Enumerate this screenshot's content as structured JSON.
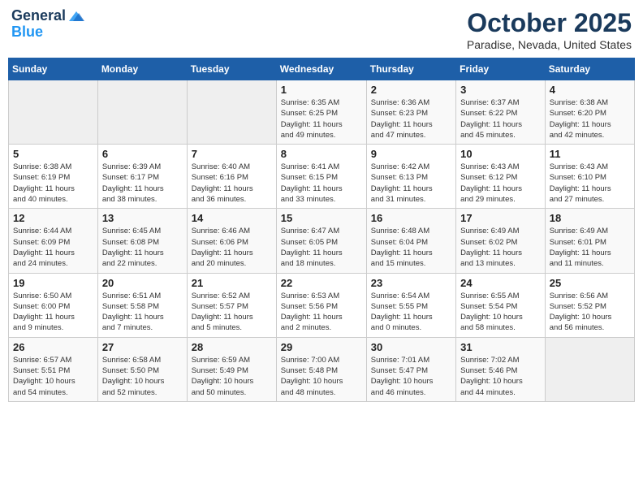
{
  "header": {
    "logo_general": "General",
    "logo_blue": "Blue",
    "month": "October 2025",
    "location": "Paradise, Nevada, United States"
  },
  "days_of_week": [
    "Sunday",
    "Monday",
    "Tuesday",
    "Wednesday",
    "Thursday",
    "Friday",
    "Saturday"
  ],
  "weeks": [
    [
      {
        "day": "",
        "info": ""
      },
      {
        "day": "",
        "info": ""
      },
      {
        "day": "",
        "info": ""
      },
      {
        "day": "1",
        "info": "Sunrise: 6:35 AM\nSunset: 6:25 PM\nDaylight: 11 hours\nand 49 minutes."
      },
      {
        "day": "2",
        "info": "Sunrise: 6:36 AM\nSunset: 6:23 PM\nDaylight: 11 hours\nand 47 minutes."
      },
      {
        "day": "3",
        "info": "Sunrise: 6:37 AM\nSunset: 6:22 PM\nDaylight: 11 hours\nand 45 minutes."
      },
      {
        "day": "4",
        "info": "Sunrise: 6:38 AM\nSunset: 6:20 PM\nDaylight: 11 hours\nand 42 minutes."
      }
    ],
    [
      {
        "day": "5",
        "info": "Sunrise: 6:38 AM\nSunset: 6:19 PM\nDaylight: 11 hours\nand 40 minutes."
      },
      {
        "day": "6",
        "info": "Sunrise: 6:39 AM\nSunset: 6:17 PM\nDaylight: 11 hours\nand 38 minutes."
      },
      {
        "day": "7",
        "info": "Sunrise: 6:40 AM\nSunset: 6:16 PM\nDaylight: 11 hours\nand 36 minutes."
      },
      {
        "day": "8",
        "info": "Sunrise: 6:41 AM\nSunset: 6:15 PM\nDaylight: 11 hours\nand 33 minutes."
      },
      {
        "day": "9",
        "info": "Sunrise: 6:42 AM\nSunset: 6:13 PM\nDaylight: 11 hours\nand 31 minutes."
      },
      {
        "day": "10",
        "info": "Sunrise: 6:43 AM\nSunset: 6:12 PM\nDaylight: 11 hours\nand 29 minutes."
      },
      {
        "day": "11",
        "info": "Sunrise: 6:43 AM\nSunset: 6:10 PM\nDaylight: 11 hours\nand 27 minutes."
      }
    ],
    [
      {
        "day": "12",
        "info": "Sunrise: 6:44 AM\nSunset: 6:09 PM\nDaylight: 11 hours\nand 24 minutes."
      },
      {
        "day": "13",
        "info": "Sunrise: 6:45 AM\nSunset: 6:08 PM\nDaylight: 11 hours\nand 22 minutes."
      },
      {
        "day": "14",
        "info": "Sunrise: 6:46 AM\nSunset: 6:06 PM\nDaylight: 11 hours\nand 20 minutes."
      },
      {
        "day": "15",
        "info": "Sunrise: 6:47 AM\nSunset: 6:05 PM\nDaylight: 11 hours\nand 18 minutes."
      },
      {
        "day": "16",
        "info": "Sunrise: 6:48 AM\nSunset: 6:04 PM\nDaylight: 11 hours\nand 15 minutes."
      },
      {
        "day": "17",
        "info": "Sunrise: 6:49 AM\nSunset: 6:02 PM\nDaylight: 11 hours\nand 13 minutes."
      },
      {
        "day": "18",
        "info": "Sunrise: 6:49 AM\nSunset: 6:01 PM\nDaylight: 11 hours\nand 11 minutes."
      }
    ],
    [
      {
        "day": "19",
        "info": "Sunrise: 6:50 AM\nSunset: 6:00 PM\nDaylight: 11 hours\nand 9 minutes."
      },
      {
        "day": "20",
        "info": "Sunrise: 6:51 AM\nSunset: 5:58 PM\nDaylight: 11 hours\nand 7 minutes."
      },
      {
        "day": "21",
        "info": "Sunrise: 6:52 AM\nSunset: 5:57 PM\nDaylight: 11 hours\nand 5 minutes."
      },
      {
        "day": "22",
        "info": "Sunrise: 6:53 AM\nSunset: 5:56 PM\nDaylight: 11 hours\nand 2 minutes."
      },
      {
        "day": "23",
        "info": "Sunrise: 6:54 AM\nSunset: 5:55 PM\nDaylight: 11 hours\nand 0 minutes."
      },
      {
        "day": "24",
        "info": "Sunrise: 6:55 AM\nSunset: 5:54 PM\nDaylight: 10 hours\nand 58 minutes."
      },
      {
        "day": "25",
        "info": "Sunrise: 6:56 AM\nSunset: 5:52 PM\nDaylight: 10 hours\nand 56 minutes."
      }
    ],
    [
      {
        "day": "26",
        "info": "Sunrise: 6:57 AM\nSunset: 5:51 PM\nDaylight: 10 hours\nand 54 minutes."
      },
      {
        "day": "27",
        "info": "Sunrise: 6:58 AM\nSunset: 5:50 PM\nDaylight: 10 hours\nand 52 minutes."
      },
      {
        "day": "28",
        "info": "Sunrise: 6:59 AM\nSunset: 5:49 PM\nDaylight: 10 hours\nand 50 minutes."
      },
      {
        "day": "29",
        "info": "Sunrise: 7:00 AM\nSunset: 5:48 PM\nDaylight: 10 hours\nand 48 minutes."
      },
      {
        "day": "30",
        "info": "Sunrise: 7:01 AM\nSunset: 5:47 PM\nDaylight: 10 hours\nand 46 minutes."
      },
      {
        "day": "31",
        "info": "Sunrise: 7:02 AM\nSunset: 5:46 PM\nDaylight: 10 hours\nand 44 minutes."
      },
      {
        "day": "",
        "info": ""
      }
    ]
  ]
}
